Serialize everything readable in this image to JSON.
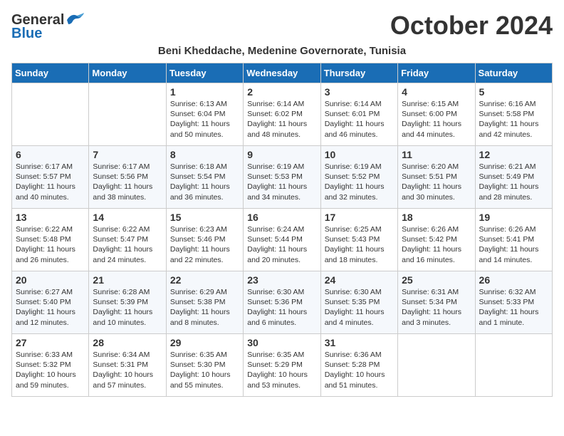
{
  "header": {
    "logo_line1": "General",
    "logo_line2": "Blue",
    "month": "October 2024",
    "location": "Beni Kheddache, Medenine Governorate, Tunisia"
  },
  "days_of_week": [
    "Sunday",
    "Monday",
    "Tuesday",
    "Wednesday",
    "Thursday",
    "Friday",
    "Saturday"
  ],
  "weeks": [
    [
      {
        "day": "",
        "sunrise": "",
        "sunset": "",
        "daylight": ""
      },
      {
        "day": "",
        "sunrise": "",
        "sunset": "",
        "daylight": ""
      },
      {
        "day": "1",
        "sunrise": "Sunrise: 6:13 AM",
        "sunset": "Sunset: 6:04 PM",
        "daylight": "Daylight: 11 hours and 50 minutes."
      },
      {
        "day": "2",
        "sunrise": "Sunrise: 6:14 AM",
        "sunset": "Sunset: 6:02 PM",
        "daylight": "Daylight: 11 hours and 48 minutes."
      },
      {
        "day": "3",
        "sunrise": "Sunrise: 6:14 AM",
        "sunset": "Sunset: 6:01 PM",
        "daylight": "Daylight: 11 hours and 46 minutes."
      },
      {
        "day": "4",
        "sunrise": "Sunrise: 6:15 AM",
        "sunset": "Sunset: 6:00 PM",
        "daylight": "Daylight: 11 hours and 44 minutes."
      },
      {
        "day": "5",
        "sunrise": "Sunrise: 6:16 AM",
        "sunset": "Sunset: 5:58 PM",
        "daylight": "Daylight: 11 hours and 42 minutes."
      }
    ],
    [
      {
        "day": "6",
        "sunrise": "Sunrise: 6:17 AM",
        "sunset": "Sunset: 5:57 PM",
        "daylight": "Daylight: 11 hours and 40 minutes."
      },
      {
        "day": "7",
        "sunrise": "Sunrise: 6:17 AM",
        "sunset": "Sunset: 5:56 PM",
        "daylight": "Daylight: 11 hours and 38 minutes."
      },
      {
        "day": "8",
        "sunrise": "Sunrise: 6:18 AM",
        "sunset": "Sunset: 5:54 PM",
        "daylight": "Daylight: 11 hours and 36 minutes."
      },
      {
        "day": "9",
        "sunrise": "Sunrise: 6:19 AM",
        "sunset": "Sunset: 5:53 PM",
        "daylight": "Daylight: 11 hours and 34 minutes."
      },
      {
        "day": "10",
        "sunrise": "Sunrise: 6:19 AM",
        "sunset": "Sunset: 5:52 PM",
        "daylight": "Daylight: 11 hours and 32 minutes."
      },
      {
        "day": "11",
        "sunrise": "Sunrise: 6:20 AM",
        "sunset": "Sunset: 5:51 PM",
        "daylight": "Daylight: 11 hours and 30 minutes."
      },
      {
        "day": "12",
        "sunrise": "Sunrise: 6:21 AM",
        "sunset": "Sunset: 5:49 PM",
        "daylight": "Daylight: 11 hours and 28 minutes."
      }
    ],
    [
      {
        "day": "13",
        "sunrise": "Sunrise: 6:22 AM",
        "sunset": "Sunset: 5:48 PM",
        "daylight": "Daylight: 11 hours and 26 minutes."
      },
      {
        "day": "14",
        "sunrise": "Sunrise: 6:22 AM",
        "sunset": "Sunset: 5:47 PM",
        "daylight": "Daylight: 11 hours and 24 minutes."
      },
      {
        "day": "15",
        "sunrise": "Sunrise: 6:23 AM",
        "sunset": "Sunset: 5:46 PM",
        "daylight": "Daylight: 11 hours and 22 minutes."
      },
      {
        "day": "16",
        "sunrise": "Sunrise: 6:24 AM",
        "sunset": "Sunset: 5:44 PM",
        "daylight": "Daylight: 11 hours and 20 minutes."
      },
      {
        "day": "17",
        "sunrise": "Sunrise: 6:25 AM",
        "sunset": "Sunset: 5:43 PM",
        "daylight": "Daylight: 11 hours and 18 minutes."
      },
      {
        "day": "18",
        "sunrise": "Sunrise: 6:26 AM",
        "sunset": "Sunset: 5:42 PM",
        "daylight": "Daylight: 11 hours and 16 minutes."
      },
      {
        "day": "19",
        "sunrise": "Sunrise: 6:26 AM",
        "sunset": "Sunset: 5:41 PM",
        "daylight": "Daylight: 11 hours and 14 minutes."
      }
    ],
    [
      {
        "day": "20",
        "sunrise": "Sunrise: 6:27 AM",
        "sunset": "Sunset: 5:40 PM",
        "daylight": "Daylight: 11 hours and 12 minutes."
      },
      {
        "day": "21",
        "sunrise": "Sunrise: 6:28 AM",
        "sunset": "Sunset: 5:39 PM",
        "daylight": "Daylight: 11 hours and 10 minutes."
      },
      {
        "day": "22",
        "sunrise": "Sunrise: 6:29 AM",
        "sunset": "Sunset: 5:38 PM",
        "daylight": "Daylight: 11 hours and 8 minutes."
      },
      {
        "day": "23",
        "sunrise": "Sunrise: 6:30 AM",
        "sunset": "Sunset: 5:36 PM",
        "daylight": "Daylight: 11 hours and 6 minutes."
      },
      {
        "day": "24",
        "sunrise": "Sunrise: 6:30 AM",
        "sunset": "Sunset: 5:35 PM",
        "daylight": "Daylight: 11 hours and 4 minutes."
      },
      {
        "day": "25",
        "sunrise": "Sunrise: 6:31 AM",
        "sunset": "Sunset: 5:34 PM",
        "daylight": "Daylight: 11 hours and 3 minutes."
      },
      {
        "day": "26",
        "sunrise": "Sunrise: 6:32 AM",
        "sunset": "Sunset: 5:33 PM",
        "daylight": "Daylight: 11 hours and 1 minute."
      }
    ],
    [
      {
        "day": "27",
        "sunrise": "Sunrise: 6:33 AM",
        "sunset": "Sunset: 5:32 PM",
        "daylight": "Daylight: 10 hours and 59 minutes."
      },
      {
        "day": "28",
        "sunrise": "Sunrise: 6:34 AM",
        "sunset": "Sunset: 5:31 PM",
        "daylight": "Daylight: 10 hours and 57 minutes."
      },
      {
        "day": "29",
        "sunrise": "Sunrise: 6:35 AM",
        "sunset": "Sunset: 5:30 PM",
        "daylight": "Daylight: 10 hours and 55 minutes."
      },
      {
        "day": "30",
        "sunrise": "Sunrise: 6:35 AM",
        "sunset": "Sunset: 5:29 PM",
        "daylight": "Daylight: 10 hours and 53 minutes."
      },
      {
        "day": "31",
        "sunrise": "Sunrise: 6:36 AM",
        "sunset": "Sunset: 5:28 PM",
        "daylight": "Daylight: 10 hours and 51 minutes."
      },
      {
        "day": "",
        "sunrise": "",
        "sunset": "",
        "daylight": ""
      },
      {
        "day": "",
        "sunrise": "",
        "sunset": "",
        "daylight": ""
      }
    ]
  ]
}
